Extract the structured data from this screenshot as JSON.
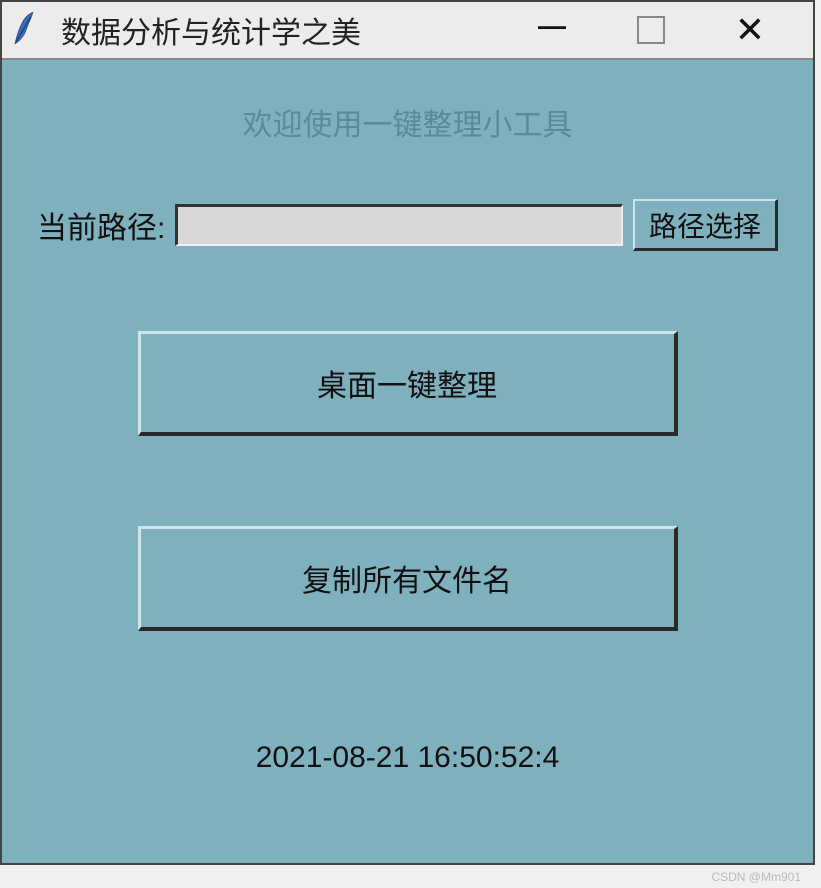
{
  "window": {
    "title": "数据分析与统计学之美"
  },
  "welcome_text": "欢迎使用一键整理小工具",
  "path": {
    "label": "当前路径:",
    "value": "",
    "browse_button": "路径选择"
  },
  "buttons": {
    "desktop_cleanup": "桌面一键整理",
    "copy_filenames": "复制所有文件名"
  },
  "timestamp": "2021-08-21 16:50:52:4",
  "watermark": "CSDN @Mm901"
}
